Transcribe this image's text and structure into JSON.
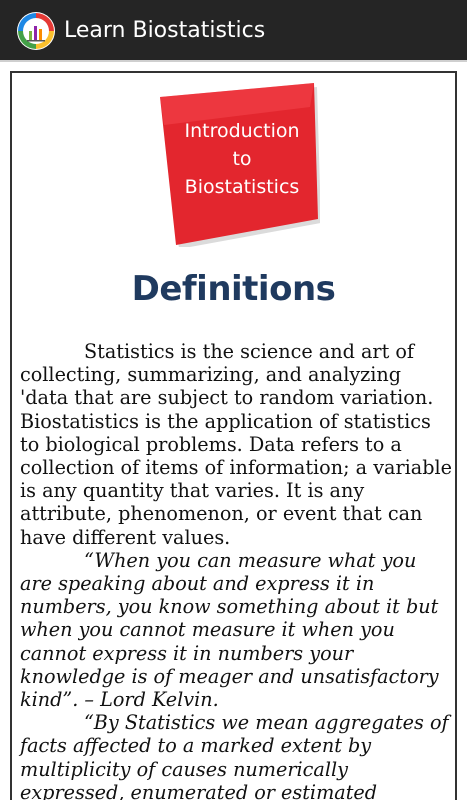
{
  "app": {
    "title": "Learn Biostatistics",
    "colors": {
      "appbar": "#252525",
      "heading": "#1f3a5f",
      "banner_red": "#e3262e"
    }
  },
  "banner": {
    "line1": "Introduction",
    "line2": "to",
    "line3": "Biostatistics"
  },
  "article": {
    "heading": "Definitions",
    "paragraphs": [
      "Statistics is the science and art of collecting, summarizing, and analyzing 'data that are subject to random variation. Biostatistics is the application of statistics to biological problems. Data refers to a collection of items of information; a variable is any quantity that varies. It is any attribute, phenomenon, or event that can have different values.",
      "“When you can measure what you are speaking about and express it in numbers, you know something about it but when you cannot measure it when you cannot express it in numbers your knowledge is of meager and unsatisfactory kind”. – Lord Kelvin.",
      "“By Statistics we mean aggregates of facts affected to a marked extent by multiplicity of causes numerically expressed, enumerated or estimated"
    ]
  }
}
